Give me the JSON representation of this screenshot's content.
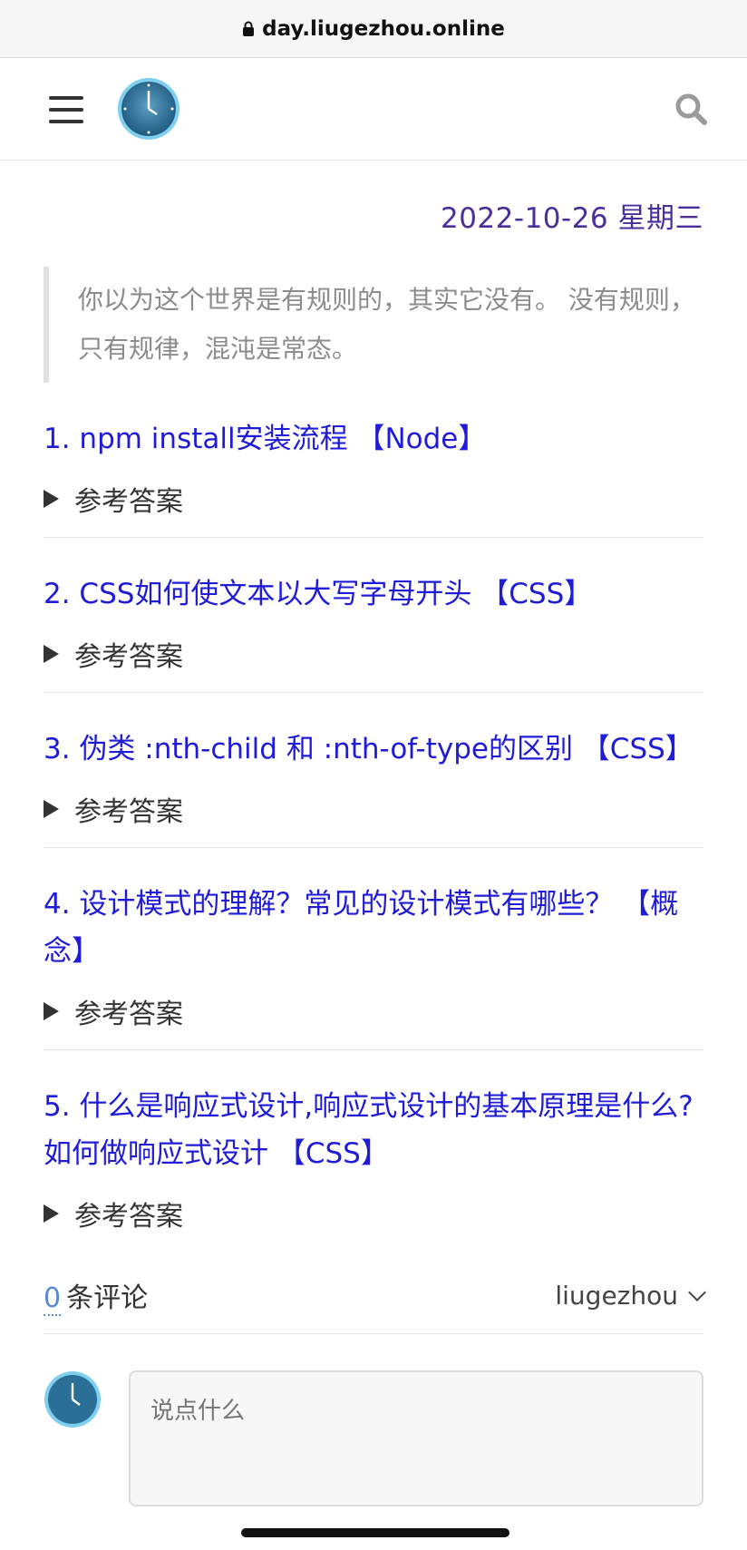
{
  "browser": {
    "url": "day.liugezhou.online"
  },
  "header": {
    "menu_icon": "hamburger-icon",
    "logo_icon": "clock-logo-icon",
    "search_icon": "search-icon"
  },
  "date": "2022-10-26 星期三",
  "quote": "你以为这个世界是有规则的，其实它没有。 没有规则，只有规律，混沌是常态。",
  "questions": [
    {
      "title": "1. npm install安装流程 【Node】",
      "answer_label": "参考答案"
    },
    {
      "title": "2. CSS如何使文本以大写字母开头 【CSS】",
      "answer_label": "参考答案"
    },
    {
      "title": "3. 伪类 :nth-child 和 :nth-of-type的区别 【CSS】",
      "answer_label": "参考答案"
    },
    {
      "title": "4. 设计模式的理解？常见的设计模式有哪些？ 【概念】",
      "answer_label": "参考答案"
    },
    {
      "title": "5. 什么是响应式设计,响应式设计的基本原理是什么?如何做响应式设计 【CSS】",
      "answer_label": "参考答案"
    }
  ],
  "comments": {
    "count": "0",
    "count_suffix": "条评论",
    "user": "liugezhou",
    "placeholder": "说点什么"
  },
  "colors": {
    "link": "#1f1bd8",
    "date": "#4a2e9c",
    "quote": "#8c8c8c"
  }
}
